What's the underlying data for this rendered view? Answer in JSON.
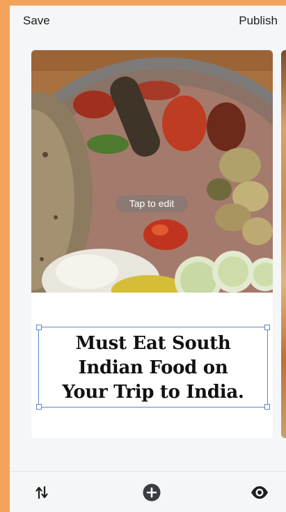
{
  "topbar": {
    "save_label": "Save",
    "publish_label": "Publish"
  },
  "card": {
    "photo_alt": "South Indian thali with chapati, rice and vegetables",
    "tap_label": "Tap to edit",
    "title_lines": [
      "Must Eat South",
      "Indian Food on",
      "Your Trip to India."
    ]
  },
  "bottombar": {
    "icons": [
      "reorder-icon",
      "add-icon",
      "preview-icon"
    ]
  },
  "colors": {
    "frame": "#f3a35c",
    "selection": "#5b85c8"
  }
}
